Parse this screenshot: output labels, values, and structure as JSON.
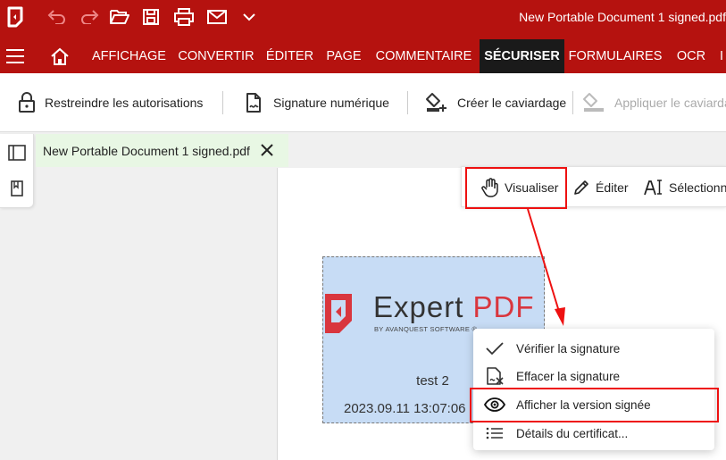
{
  "window": {
    "title": "New Portable Document 1 signed.pdf"
  },
  "quick_access": {
    "icons": [
      "app-logo-icon",
      "undo-icon",
      "redo-icon",
      "open-folder-icon",
      "save-icon",
      "print-icon",
      "mail-icon",
      "chevron-down-icon"
    ]
  },
  "ribbon": {
    "tabs": [
      {
        "label": "AFFICHAGE",
        "active": false
      },
      {
        "label": "CONVERTIR",
        "active": false
      },
      {
        "label": "ÉDITER",
        "active": false
      },
      {
        "label": "PAGE",
        "active": false
      },
      {
        "label": "COMMENTAIRE",
        "active": false
      },
      {
        "label": "SÉCURISER",
        "active": true
      },
      {
        "label": "FORMULAIRES",
        "active": false
      },
      {
        "label": "OCR",
        "active": false
      },
      {
        "label": "I",
        "active": false
      }
    ]
  },
  "toolbar": {
    "restrict_label": "Restreindre les autorisations",
    "digital_signature_label": "Signature numérique",
    "create_redaction_label": "Créer le caviardage",
    "apply_redaction_label": "Appliquer le caviardage"
  },
  "document_tab": {
    "label": "New Portable Document 1 signed.pdf"
  },
  "mode_bar": {
    "view_label": "Visualiser",
    "edit_label": "Éditer",
    "select_label": "Sélectionner"
  },
  "signature": {
    "brand_expert": "Expert",
    "brand_pdf": "PDF",
    "by_line": "BY AVANQUEST SOFTWARE ®",
    "signer_name": "test 2",
    "date": "2023.09.11 13:07:06"
  },
  "context_menu": {
    "items": [
      {
        "label": "Vérifier la signature",
        "icon": "check-icon"
      },
      {
        "label": "Effacer la signature",
        "icon": "clear-signature-icon"
      },
      {
        "label": "Afficher la version signée",
        "icon": "eye-icon",
        "highlighted": true
      },
      {
        "label": "Détails du certificat...",
        "icon": "list-icon"
      }
    ]
  },
  "colors": {
    "brand_red": "#b5120f",
    "active_tab": "#1a1a1a",
    "annotation_red": "#e11111",
    "signature_bg": "#c7dcf5",
    "doc_tab_bg": "#e8f7e4"
  }
}
